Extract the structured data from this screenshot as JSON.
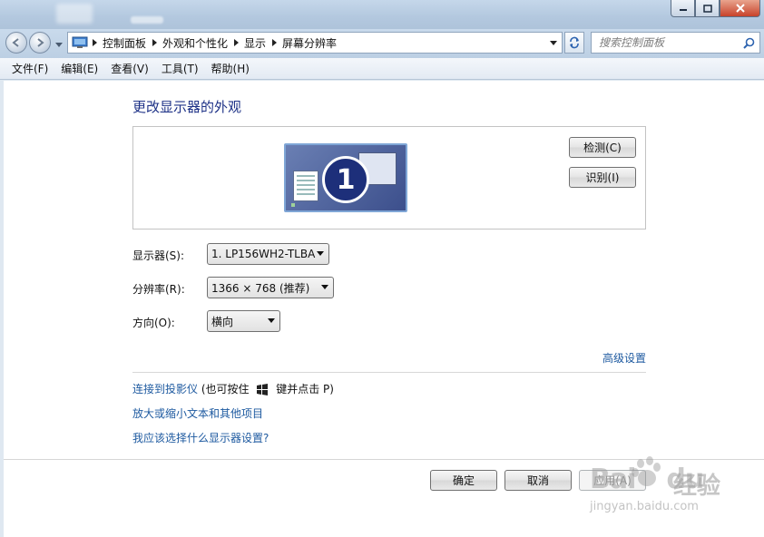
{
  "breadcrumbs": [
    "控制面板",
    "外观和个性化",
    "显示",
    "屏幕分辨率"
  ],
  "search": {
    "placeholder": "搜索控制面板"
  },
  "menu": [
    "文件(F)",
    "编辑(E)",
    "查看(V)",
    "工具(T)",
    "帮助(H)"
  ],
  "heading": "更改显示器的外观",
  "monitor_preview": {
    "number": "1",
    "detect_label": "检测(C)",
    "identify_label": "识别(I)"
  },
  "settings": {
    "display": {
      "label": "显示器(S):",
      "value": "1. LP156WH2-TLBA"
    },
    "resolution": {
      "label": "分辨率(R):",
      "value": "1366 × 768 (推荐)"
    },
    "orientation": {
      "label": "方向(O):",
      "value": "横向"
    }
  },
  "advanced_link": "高级设置",
  "links": {
    "projector": "连接到投影仪",
    "projector_hint_pre": "(也可按住",
    "projector_hint_post": "键并点击 P)",
    "text_size": "放大或缩小文本和其他项目",
    "help": "我应该选择什么显示器设置?"
  },
  "buttons": {
    "ok": "确定",
    "cancel": "取消",
    "apply": "应用(A)"
  },
  "watermark": {
    "logo": "Bai",
    "logo2": "du",
    "cn": "经验",
    "url": "jingyan.baidu.com"
  }
}
